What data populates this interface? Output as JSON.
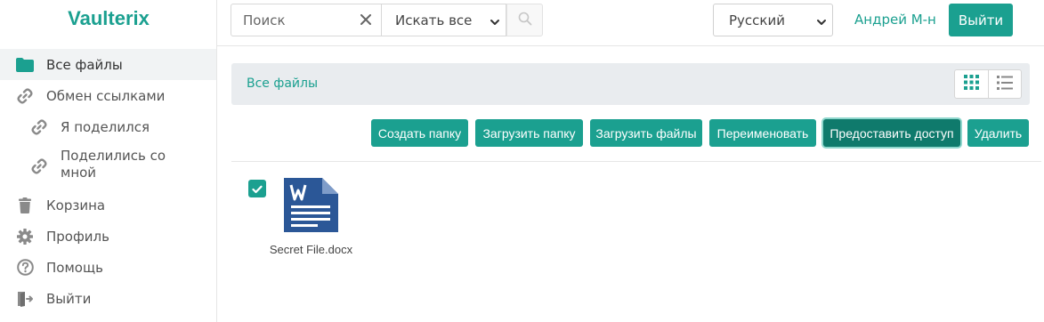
{
  "app": {
    "name": "Vaulterix",
    "accent_color": "#1ba090"
  },
  "sidebar": {
    "items": [
      {
        "label": "Все файлы",
        "icon": "folder-icon",
        "active": true
      },
      {
        "label": "Обмен ссылками",
        "icon": "link-icon"
      },
      {
        "label": "Я поделился",
        "icon": "link-icon"
      },
      {
        "label": "Поделились со мной",
        "icon": "link-icon"
      },
      {
        "label": "Корзина",
        "icon": "trash-icon"
      },
      {
        "label": "Профиль",
        "icon": "gear-icon"
      },
      {
        "label": "Помощь",
        "icon": "help-icon"
      },
      {
        "label": "Выйти",
        "icon": "logout-icon"
      }
    ]
  },
  "header": {
    "search": {
      "placeholder": "Поиск",
      "value": ""
    },
    "scope": {
      "selected": "Искать все"
    },
    "language": {
      "selected": "Русский"
    },
    "user": "Андрей М-н",
    "logout_label": "Выйти"
  },
  "breadcrumb": {
    "current": "Все файлы"
  },
  "view": {
    "mode": "grid"
  },
  "toolbar": {
    "create_folder": "Создать папку",
    "upload_folder": "Загрузить папку",
    "upload_files": "Загрузить файлы",
    "rename": "Переименовать",
    "share": "Предоставить доступ",
    "delete": "Удалить"
  },
  "files": [
    {
      "name": "Secret File.docx",
      "type": "docx",
      "selected": true,
      "icon": "word-document-icon"
    }
  ]
}
